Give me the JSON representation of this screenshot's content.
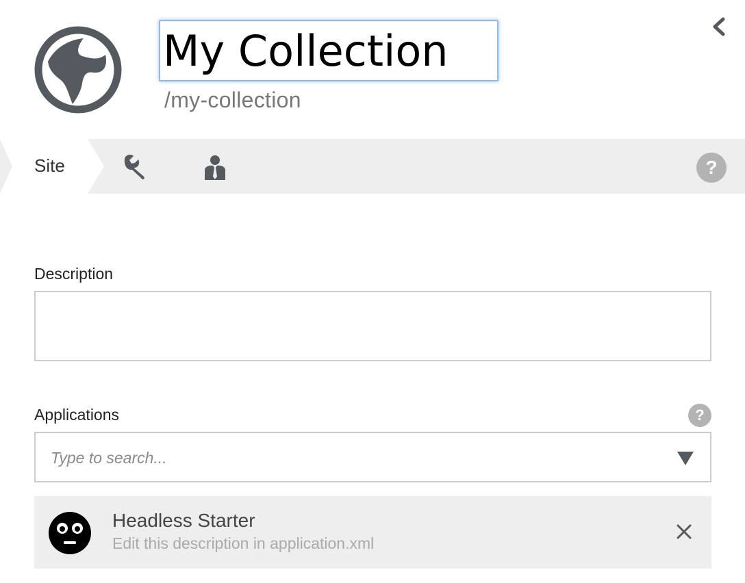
{
  "header": {
    "site_name": "My Collection",
    "site_path": "/my-collection",
    "site_icon": "globe-icon",
    "back_icon": "chevron-left-icon"
  },
  "tabs": {
    "site_label": "Site",
    "tools_icon": "wrench-icon",
    "users_icon": "person-icon",
    "help_icon": "?"
  },
  "form": {
    "description_label": "Description",
    "description_value": "",
    "applications_label": "Applications",
    "applications_help": "?",
    "search_placeholder": "Type to search...",
    "dropdown_icon": "triangle-down-icon"
  },
  "applications": [
    {
      "name": "Headless Starter",
      "description": "Edit this description in application.xml",
      "icon": "face-icon",
      "remove_icon": "close-icon"
    }
  ],
  "colors": {
    "icon_dark": "#555a60",
    "tabbar_bg": "#eeeeee",
    "help_bg": "#b3b3b3",
    "focus_border": "#8bbbe8"
  }
}
